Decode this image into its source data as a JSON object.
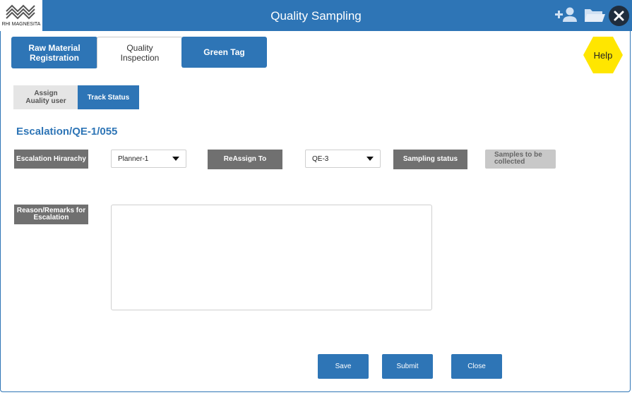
{
  "header": {
    "brand": "RHI MAGNESITA",
    "title": "Quality Sampling",
    "icons": [
      "logo-icon",
      "add-user-icon",
      "folder-icon",
      "close-icon"
    ]
  },
  "tabs": [
    {
      "label": "Raw Material\nRegistration",
      "active": false
    },
    {
      "label": "Quality\nInspection",
      "active": true
    },
    {
      "label": "Green Tag",
      "active": false
    }
  ],
  "help_label": "Help",
  "subtabs": [
    {
      "label": "Assign\nAuality user",
      "active": false
    },
    {
      "label": "Track Status",
      "active": true
    }
  ],
  "reference": "Escalation/QE-1/055",
  "form": {
    "escalation_label": "Escalation Hirarachy",
    "escalation_value": "Planner-1",
    "reassign_label": "ReAssign To",
    "reassign_value": "QE-3",
    "sampling_label": "Sampling status",
    "sampling_value": "Samples to be\ncollected",
    "remarks_label": "Reason/Remarks for\nEscalation",
    "remarks_value": ""
  },
  "buttons": {
    "save": "Save",
    "submit": "Submit",
    "close": "Close"
  },
  "colors": {
    "primary": "#2e75b6",
    "help": "#ffe600",
    "label_gray": "#707070"
  }
}
